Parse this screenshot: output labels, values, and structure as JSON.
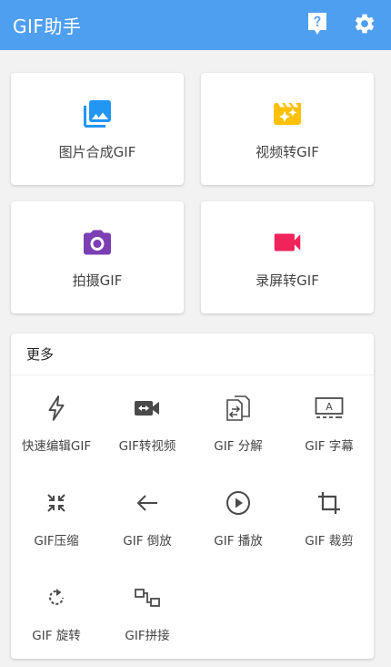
{
  "appbar": {
    "title": "GIF助手",
    "help_icon": "help-icon",
    "settings_icon": "gear-icon"
  },
  "main_cards": [
    {
      "label": "图片合成GIF",
      "icon": "photo-library-icon",
      "color": "#2196f3"
    },
    {
      "label": "视频转GIF",
      "icon": "movie-filter-icon",
      "color": "#ffc107"
    },
    {
      "label": "拍摄GIF",
      "icon": "camera-icon",
      "color": "#7b3fb3"
    },
    {
      "label": "录屏转GIF",
      "icon": "videocam-icon",
      "color": "#f0245a"
    }
  ],
  "more": {
    "title": "更多",
    "tools": [
      {
        "label": "快速编辑GIF",
        "icon": "flash-icon"
      },
      {
        "label": "GIF转视频",
        "icon": "video-convert-icon"
      },
      {
        "label": "GIF 分解",
        "icon": "split-icon"
      },
      {
        "label": "GIF 字幕",
        "icon": "subtitle-icon"
      },
      {
        "label": "GIF压缩",
        "icon": "compress-icon"
      },
      {
        "label": "GIF 倒放",
        "icon": "arrow-back-icon"
      },
      {
        "label": "GIF 播放",
        "icon": "play-icon"
      },
      {
        "label": "GIF 裁剪",
        "icon": "crop-icon"
      },
      {
        "label": "GIF 旋转",
        "icon": "rotate-icon"
      },
      {
        "label": "GIF拼接",
        "icon": "join-icon"
      }
    ]
  },
  "colors": {
    "appbar": "#4f9ff1",
    "background": "#f2f2f2",
    "icon_dark": "#4a4a4a"
  }
}
